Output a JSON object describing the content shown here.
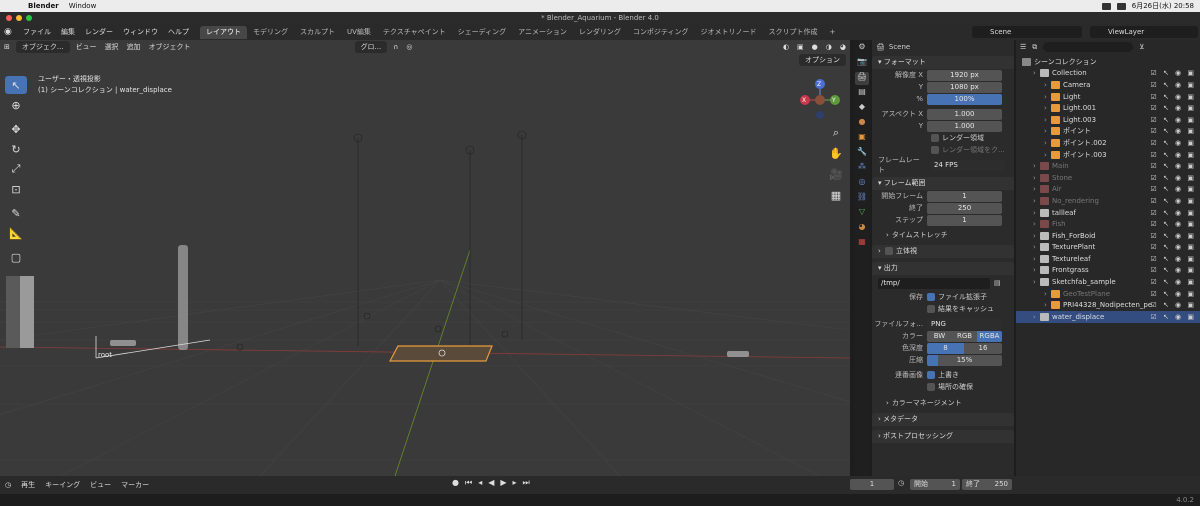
{
  "macbar": {
    "app": "Blender",
    "menu": "Window",
    "date": "6月26日(水) 20:58"
  },
  "window_title": "* Blender_Aquarium - Blender 4.0",
  "topbar": {
    "menus": [
      "ファイル",
      "編集",
      "レンダー",
      "ウィンドウ",
      "ヘルプ"
    ],
    "workspaces": [
      "レイアウト",
      "モデリング",
      "スカルプト",
      "UV編集",
      "テクスチャペイント",
      "シェーディング",
      "アニメーション",
      "レンダリング",
      "コンポジティング",
      "ジオメトリノード",
      "スクリプト作成"
    ],
    "add_tab": "+",
    "scene": "Scene",
    "view_layer": "ViewLayer"
  },
  "viewport": {
    "mode": "オブジェク...",
    "menus": [
      "ビュー",
      "選択",
      "追加",
      "オブジェクト"
    ],
    "orientation": "グロ...",
    "options": "オプション",
    "info_line1": "ユーザー・透視投影",
    "info_line2": "(1) シーンコレクション | water_displace",
    "axis_x": "X",
    "axis_y": "Y",
    "axis_z": "Z",
    "root_label": "root"
  },
  "properties": {
    "scene_label": "Scene",
    "format": {
      "title": "フォーマット",
      "res_x_label": "解像度 X",
      "res_x": "1920 px",
      "res_y_label": "Y",
      "res_y": "1080 px",
      "pct_label": "%",
      "pct": "100%",
      "aspect_x_label": "アスペクト X",
      "aspect_x": "1.000",
      "aspect_y_label": "Y",
      "aspect_y": "1.000",
      "render_region": "レンダー領域",
      "crop": "レンダー領域をク...",
      "fps_label": "フレームレート",
      "fps": "24 FPS"
    },
    "frame_range": {
      "title": "フレーム範囲",
      "start_label": "開始フレーム",
      "start": "1",
      "end_label": "終了",
      "end": "250",
      "step_label": "ステップ",
      "step": "1",
      "time_stretch": "タイムストレッチ"
    },
    "stereo": "立体視",
    "output": {
      "title": "出力",
      "path": "/tmp/",
      "save_label": "保存",
      "file_ext": "ファイル拡張子",
      "cache": "結果をキャッシュ",
      "format_label": "ファイルフォ...",
      "format": "PNG",
      "color_label": "カラー",
      "color_opts": [
        "BW",
        "RGB",
        "RGBA"
      ],
      "depth_label": "色深度",
      "depth_opts": [
        "8",
        "16"
      ],
      "compress_label": "圧縮",
      "compress": "15%",
      "seq_label": "連番画像",
      "overwrite": "上書き",
      "placeholders": "場所の確保",
      "color_mgmt": "カラーマネージメント"
    },
    "metadata": "メタデータ",
    "post": "ポストプロセッシング"
  },
  "outliner": {
    "title": "シーンコレクション",
    "rows": [
      {
        "name": "Collection",
        "indent": 1,
        "dim": false
      },
      {
        "name": "Camera",
        "indent": 2,
        "dim": false
      },
      {
        "name": "Light",
        "indent": 2,
        "dim": false
      },
      {
        "name": "Light.001",
        "indent": 2,
        "dim": false
      },
      {
        "name": "Light.003",
        "indent": 2,
        "dim": false
      },
      {
        "name": "ポイント",
        "indent": 2,
        "dim": false
      },
      {
        "name": "ポイント.002",
        "indent": 2,
        "dim": false
      },
      {
        "name": "ポイント.003",
        "indent": 2,
        "dim": false
      },
      {
        "name": "Main",
        "indent": 1,
        "dim": true
      },
      {
        "name": "Stone",
        "indent": 1,
        "dim": true
      },
      {
        "name": "Air",
        "indent": 1,
        "dim": true
      },
      {
        "name": "No_rendering",
        "indent": 1,
        "dim": true
      },
      {
        "name": "tallleaf",
        "indent": 1,
        "dim": false
      },
      {
        "name": "Fish",
        "indent": 1,
        "dim": true
      },
      {
        "name": "Fish_ForBoid",
        "indent": 1,
        "dim": false
      },
      {
        "name": "TexturePlant",
        "indent": 1,
        "dim": false
      },
      {
        "name": "Textureleaf",
        "indent": 1,
        "dim": false
      },
      {
        "name": "Frontgrass",
        "indent": 1,
        "dim": false
      },
      {
        "name": "Sketchfab_sample",
        "indent": 1,
        "dim": false
      },
      {
        "name": "GeoTestPlane",
        "indent": 2,
        "dim": true
      },
      {
        "name": "PRI44328_Nodipecten_pe",
        "indent": 2,
        "dim": false
      },
      {
        "name": "water_displace",
        "indent": 1,
        "dim": false,
        "selected": true
      }
    ]
  },
  "timeline": {
    "menus": [
      "再生",
      "キーイング",
      "ビュー",
      "マーカー"
    ],
    "current": "1",
    "start_label": "開始",
    "start": "1",
    "end_label": "終了",
    "end": "250",
    "version": "4.0.2"
  }
}
